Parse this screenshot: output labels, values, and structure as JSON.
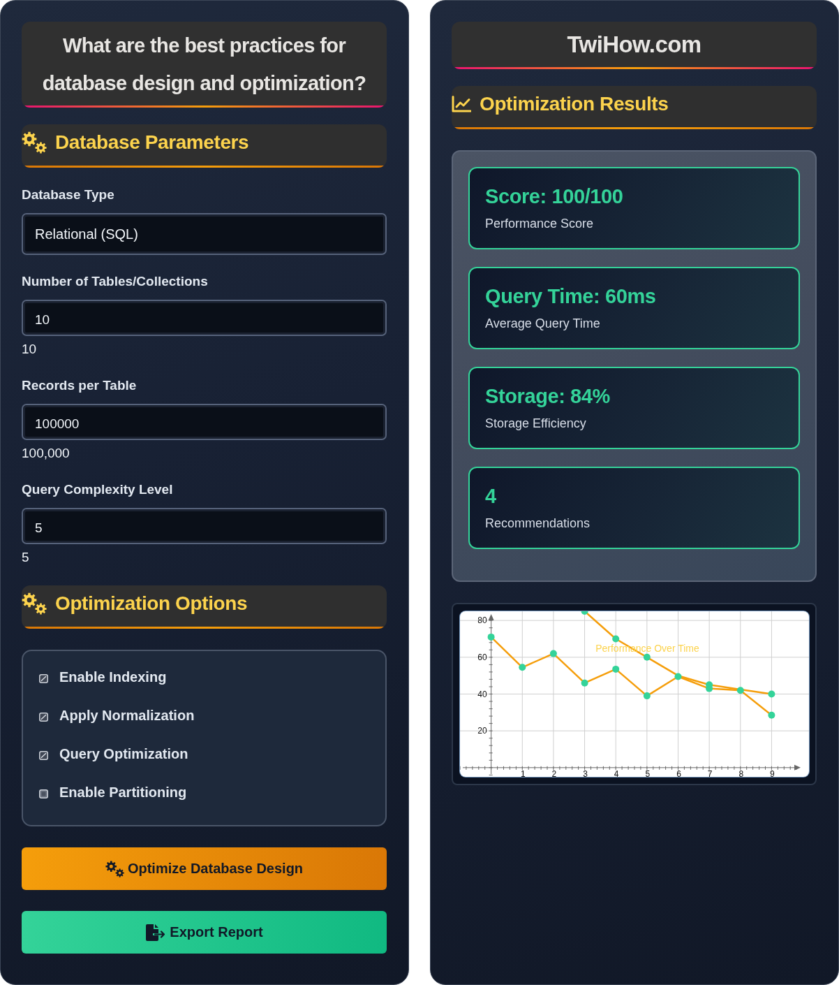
{
  "form_panel": {
    "title": "What are the best practices for database design and optimization?",
    "parameters": {
      "heading": "Database Parameters",
      "fields": [
        {
          "kind": "select",
          "label": "Database Type",
          "value": "Relational (SQL)"
        },
        {
          "kind": "number",
          "label": "Number of Tables/Collections",
          "value": "10",
          "readout": "10"
        },
        {
          "kind": "number",
          "label": "Records per Table",
          "value": "100000",
          "readout": "100,000"
        },
        {
          "kind": "number",
          "label": "Query Complexity Level",
          "value": "5",
          "readout": "5"
        }
      ]
    },
    "options": {
      "heading": "Optimization Options",
      "items": [
        {
          "label": "Enable Indexing",
          "checked": true
        },
        {
          "label": "Apply Normalization",
          "checked": true
        },
        {
          "label": "Query Optimization",
          "checked": true
        },
        {
          "label": "Enable Partitioning",
          "checked": false
        }
      ]
    },
    "buttons": [
      {
        "kind": "optimize",
        "label": "Optimize Database Design"
      },
      {
        "kind": "export",
        "label": "Export Report"
      }
    ]
  },
  "results_panel": {
    "site_title": "TwiHow.com",
    "heading": "Optimization Results",
    "metrics": [
      {
        "value": "Score: 100/100",
        "label": "Performance Score"
      },
      {
        "value": "Query Time: 60ms",
        "label": "Average Query Time"
      },
      {
        "value": "Storage: 84%",
        "label": "Storage Efficiency"
      },
      {
        "value": "4",
        "label": "Recommendations"
      }
    ],
    "chart": {
      "chart_data": {
        "type": "line",
        "title": "Performance Over Time",
        "grid": true,
        "x": [
          0,
          1,
          2,
          3,
          4,
          5,
          6,
          7,
          8,
          9
        ],
        "xlim": [
          -1,
          10.2
        ],
        "ylim": [
          -5,
          85
        ],
        "xticks": [
          1,
          2,
          3,
          4,
          5,
          6,
          7,
          8,
          9
        ],
        "yticks": [
          20,
          40,
          60,
          80
        ],
        "series": [
          {
            "color": "#f59e0b",
            "marker": "circle",
            "values": [
              71,
              54.5,
              62,
              46,
              53.5,
              39,
              49.5,
              43,
              42,
              28.5
            ]
          },
          {
            "color": "#f59e0b",
            "marker": "circle",
            "values": [
              null,
              null,
              null,
              85,
              70,
              60,
              50,
              45,
              42.5,
              40
            ]
          }
        ]
      }
    }
  }
}
